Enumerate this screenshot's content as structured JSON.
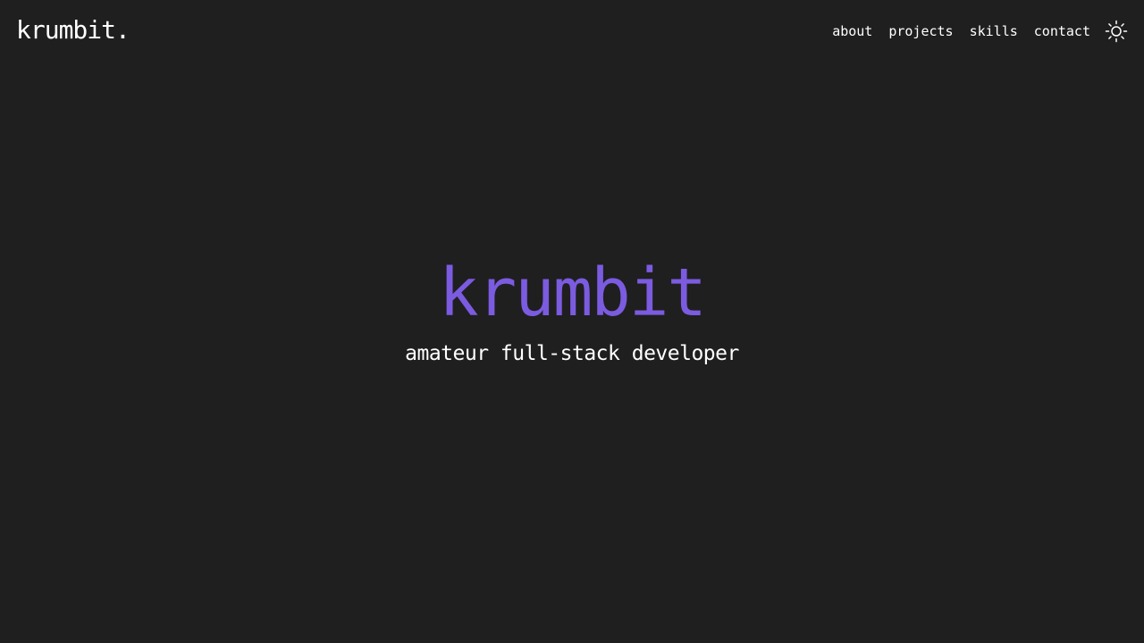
{
  "header": {
    "logo": "krumbit.",
    "nav": [
      {
        "label": "about"
      },
      {
        "label": "projects"
      },
      {
        "label": "skills"
      },
      {
        "label": "contact"
      }
    ],
    "theme_toggle_icon": "sun-icon"
  },
  "hero": {
    "title": "krumbit",
    "subtitle": "amateur full-stack developer"
  },
  "colors": {
    "background": "#1f1f1f",
    "text": "#ffffff",
    "accent": "#7b5be0"
  }
}
